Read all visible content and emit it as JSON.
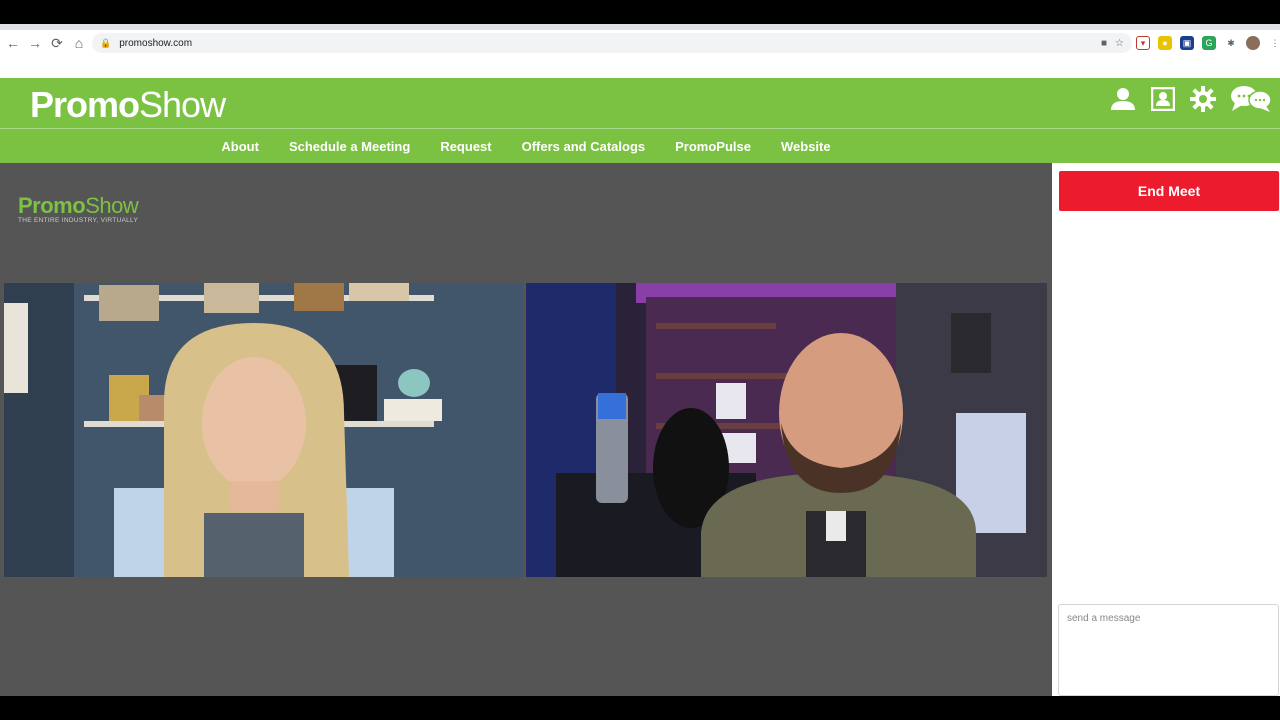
{
  "browser": {
    "url": "promoshow.com",
    "nav": {
      "back": "←",
      "forward": "→",
      "reload": "⟳",
      "home": "⌂"
    }
  },
  "header": {
    "logo_bold": "Promo",
    "logo_light": "Show",
    "accent": "#7cc242"
  },
  "nav": {
    "items": [
      "About",
      "Schedule a Meeting",
      "Request",
      "Offers and Catalogs",
      "PromoPulse",
      "Website"
    ]
  },
  "stage": {
    "logo_bold": "Promo",
    "logo_light": "Show",
    "tagline": "THE ENTIRE INDUSTRY, VIRTUALLY"
  },
  "sidebar": {
    "end_button": "End Meet",
    "end_color": "#ec1c2e",
    "message_placeholder": "send a message"
  }
}
